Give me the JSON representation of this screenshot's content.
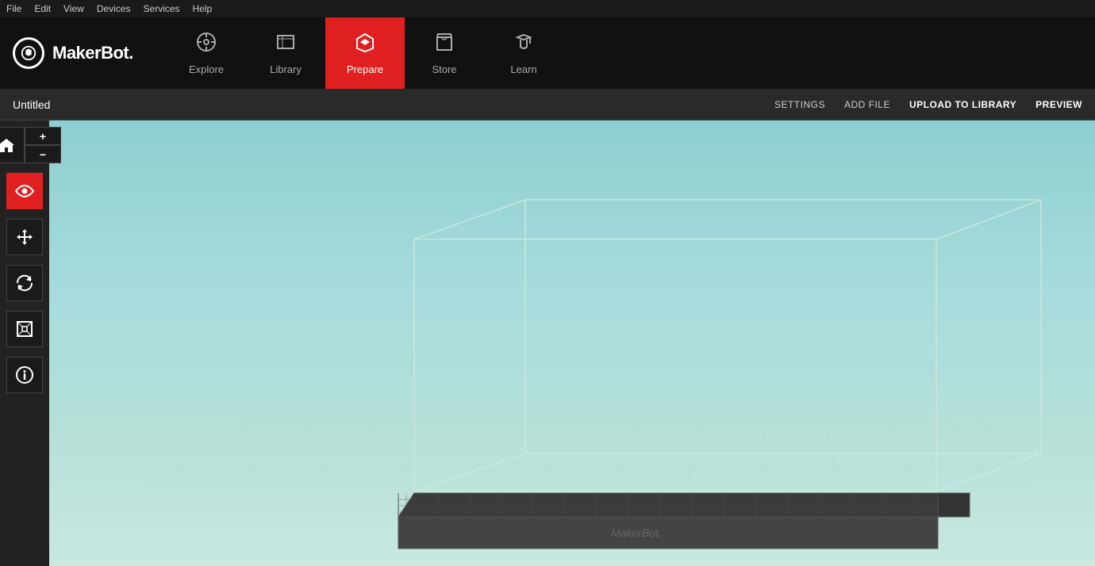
{
  "menubar": {
    "items": [
      "File",
      "Edit",
      "View",
      "Devices",
      "Services",
      "Help"
    ]
  },
  "topnav": {
    "logo_text": "MakerBot.",
    "items": [
      {
        "id": "explore",
        "label": "Explore",
        "active": false
      },
      {
        "id": "library",
        "label": "Library",
        "active": false
      },
      {
        "id": "prepare",
        "label": "Prepare",
        "active": true
      },
      {
        "id": "store",
        "label": "Store",
        "active": false
      },
      {
        "id": "learn",
        "label": "Learn",
        "active": false
      }
    ]
  },
  "toolbar": {
    "title": "Untitled",
    "actions": [
      {
        "id": "settings",
        "label": "SETTINGS"
      },
      {
        "id": "add-file",
        "label": "ADD FILE"
      },
      {
        "id": "upload-to-library",
        "label": "UPLOAD TO LIBRARY"
      },
      {
        "id": "preview",
        "label": "PREVIEW"
      }
    ]
  },
  "sidebar": {
    "groups": [
      {
        "id": "home-zoom",
        "buttons": [
          {
            "id": "home",
            "icon": "⌂",
            "type": "full",
            "active": false
          },
          {
            "id": "zoom-in",
            "icon": "+",
            "type": "half",
            "active": false
          },
          {
            "id": "zoom-out",
            "icon": "−",
            "type": "half",
            "active": false
          }
        ]
      },
      {
        "id": "view",
        "buttons": [
          {
            "id": "eye",
            "icon": "👁",
            "type": "full",
            "active": true
          }
        ]
      },
      {
        "id": "move",
        "buttons": [
          {
            "id": "move",
            "icon": "✛",
            "type": "full",
            "active": false
          }
        ]
      },
      {
        "id": "rotate",
        "buttons": [
          {
            "id": "rotate",
            "icon": "↻",
            "type": "full",
            "active": false
          }
        ]
      },
      {
        "id": "scale",
        "buttons": [
          {
            "id": "scale",
            "icon": "▣",
            "type": "full",
            "active": false
          }
        ]
      },
      {
        "id": "info",
        "buttons": [
          {
            "id": "info",
            "icon": "ℹ",
            "type": "full",
            "active": false
          }
        ]
      }
    ]
  },
  "viewport": {
    "build_plate_label": "MakerBot."
  }
}
